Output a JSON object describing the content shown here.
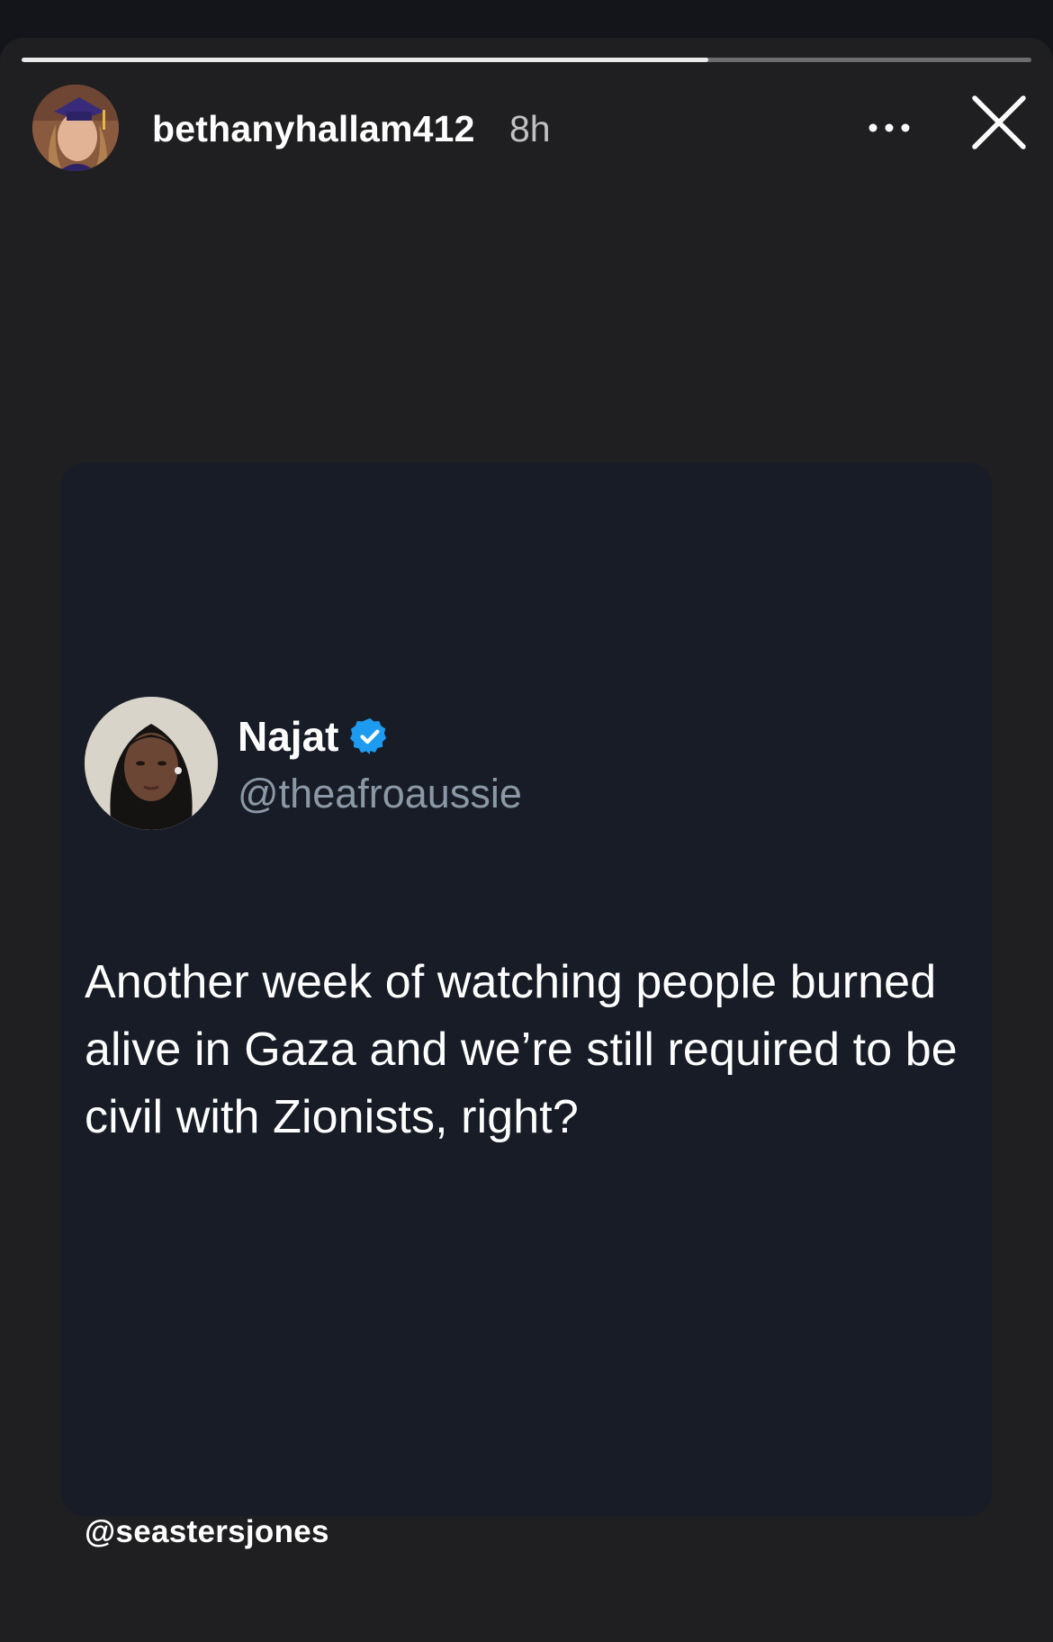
{
  "story": {
    "progress_fraction": 0.68,
    "username": "bethanyhallam412",
    "time_ago": "8h",
    "more_icon": "more-horizontal-icon",
    "close_icon": "close-icon"
  },
  "tweet": {
    "name": "Najat",
    "verified": true,
    "verified_color": "#1d9bf0",
    "handle": "@theafroaussie",
    "text": "Another week of watching people burned alive in Gaza and we’re still required to be civil with Zionists, right?"
  },
  "mention_sticker": {
    "text": "@seastersjones"
  },
  "colors": {
    "story_background": "#1f1f21",
    "card_background": "#171c26",
    "handle_gray": "#8b98a5"
  }
}
